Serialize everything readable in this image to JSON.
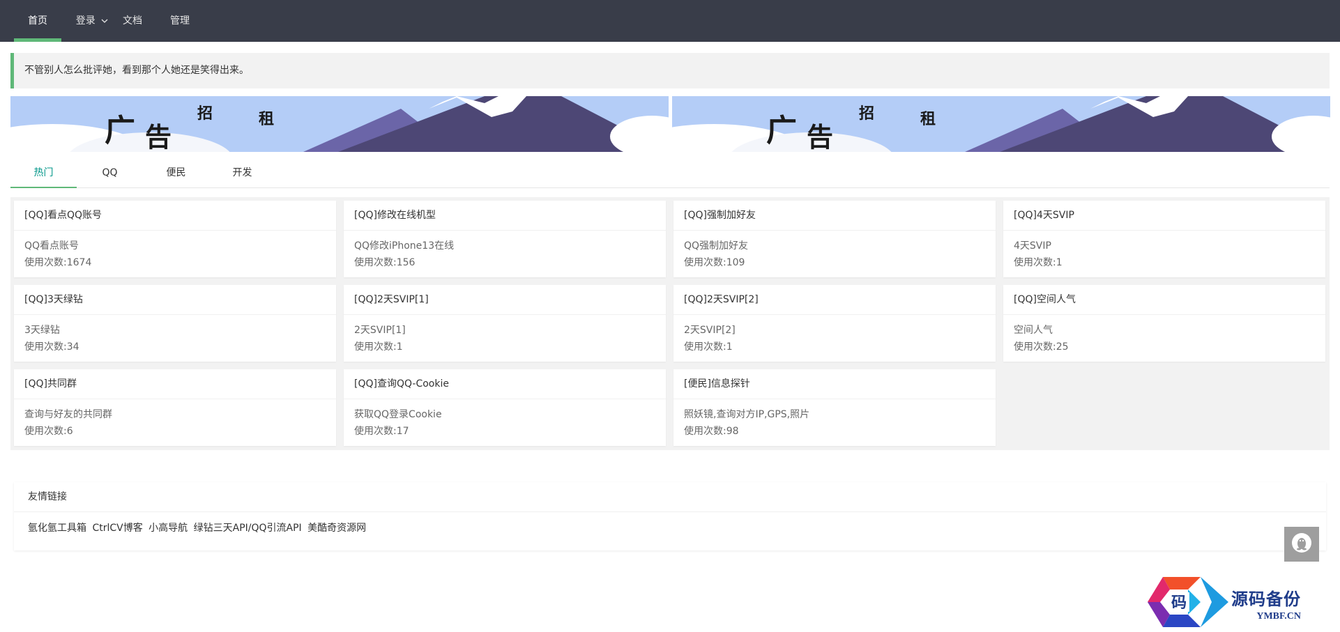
{
  "nav": {
    "items": [
      {
        "label": "首页",
        "active": true
      },
      {
        "label": "登录",
        "has_dropdown": true
      },
      {
        "label": "文档"
      },
      {
        "label": "管理"
      }
    ]
  },
  "quote": {
    "text": "不管别人怎么批评她，看到那个人她还是笑得出来。"
  },
  "banners": [
    {
      "chars": [
        "广",
        "告",
        "招",
        "租"
      ]
    },
    {
      "chars": [
        "广",
        "告",
        "招",
        "租"
      ]
    }
  ],
  "tabs": [
    {
      "label": "热门",
      "active": true
    },
    {
      "label": "QQ"
    },
    {
      "label": "便民"
    },
    {
      "label": "开发"
    }
  ],
  "cards": [
    {
      "title": "[QQ]看点QQ账号",
      "desc": "QQ看点账号",
      "usage": "使用次数:1674"
    },
    {
      "title": "[QQ]修改在线机型",
      "desc": "QQ修改iPhone13在线",
      "usage": "使用次数:156"
    },
    {
      "title": "[QQ]强制加好友",
      "desc": "QQ强制加好友",
      "usage": "使用次数:109"
    },
    {
      "title": "[QQ]4天SVIP",
      "desc": "4天SVIP",
      "usage": "使用次数:1"
    },
    {
      "title": "[QQ]3天绿钻",
      "desc": "3天绿钻",
      "usage": "使用次数:34"
    },
    {
      "title": "[QQ]2天SVIP[1]",
      "desc": "2天SVIP[1]",
      "usage": "使用次数:1"
    },
    {
      "title": "[QQ]2天SVIP[2]",
      "desc": "2天SVIP[2]",
      "usage": "使用次数:1"
    },
    {
      "title": "[QQ]空间人气",
      "desc": "空间人气",
      "usage": "使用次数:25"
    },
    {
      "title": "[QQ]共同群",
      "desc": "查询与好友的共同群",
      "usage": "使用次数:6"
    },
    {
      "title": "[QQ]查询QQ-Cookie",
      "desc": "获取QQ登录Cookie",
      "usage": "使用次数:17"
    },
    {
      "title": "[便民]信息探针",
      "desc": "照妖镜,查询对方IP,GPS,照片",
      "usage": "使用次数:98"
    }
  ],
  "links": {
    "title": "友情链接",
    "items": [
      "氩化氩工具箱",
      "CtrlCV博客",
      "小高导航",
      "绿钻三天API/QQ引流API",
      "美酷奇资源网"
    ]
  },
  "float_button": {
    "icon": "qq-penguin-icon"
  },
  "watermark": {
    "text_cn": "源码备份",
    "text_en": "YMBF.CN",
    "logo_char": "码"
  },
  "colors": {
    "nav_bg": "#393d49",
    "accent": "#5fb878",
    "tab_active_text": "#009688"
  }
}
